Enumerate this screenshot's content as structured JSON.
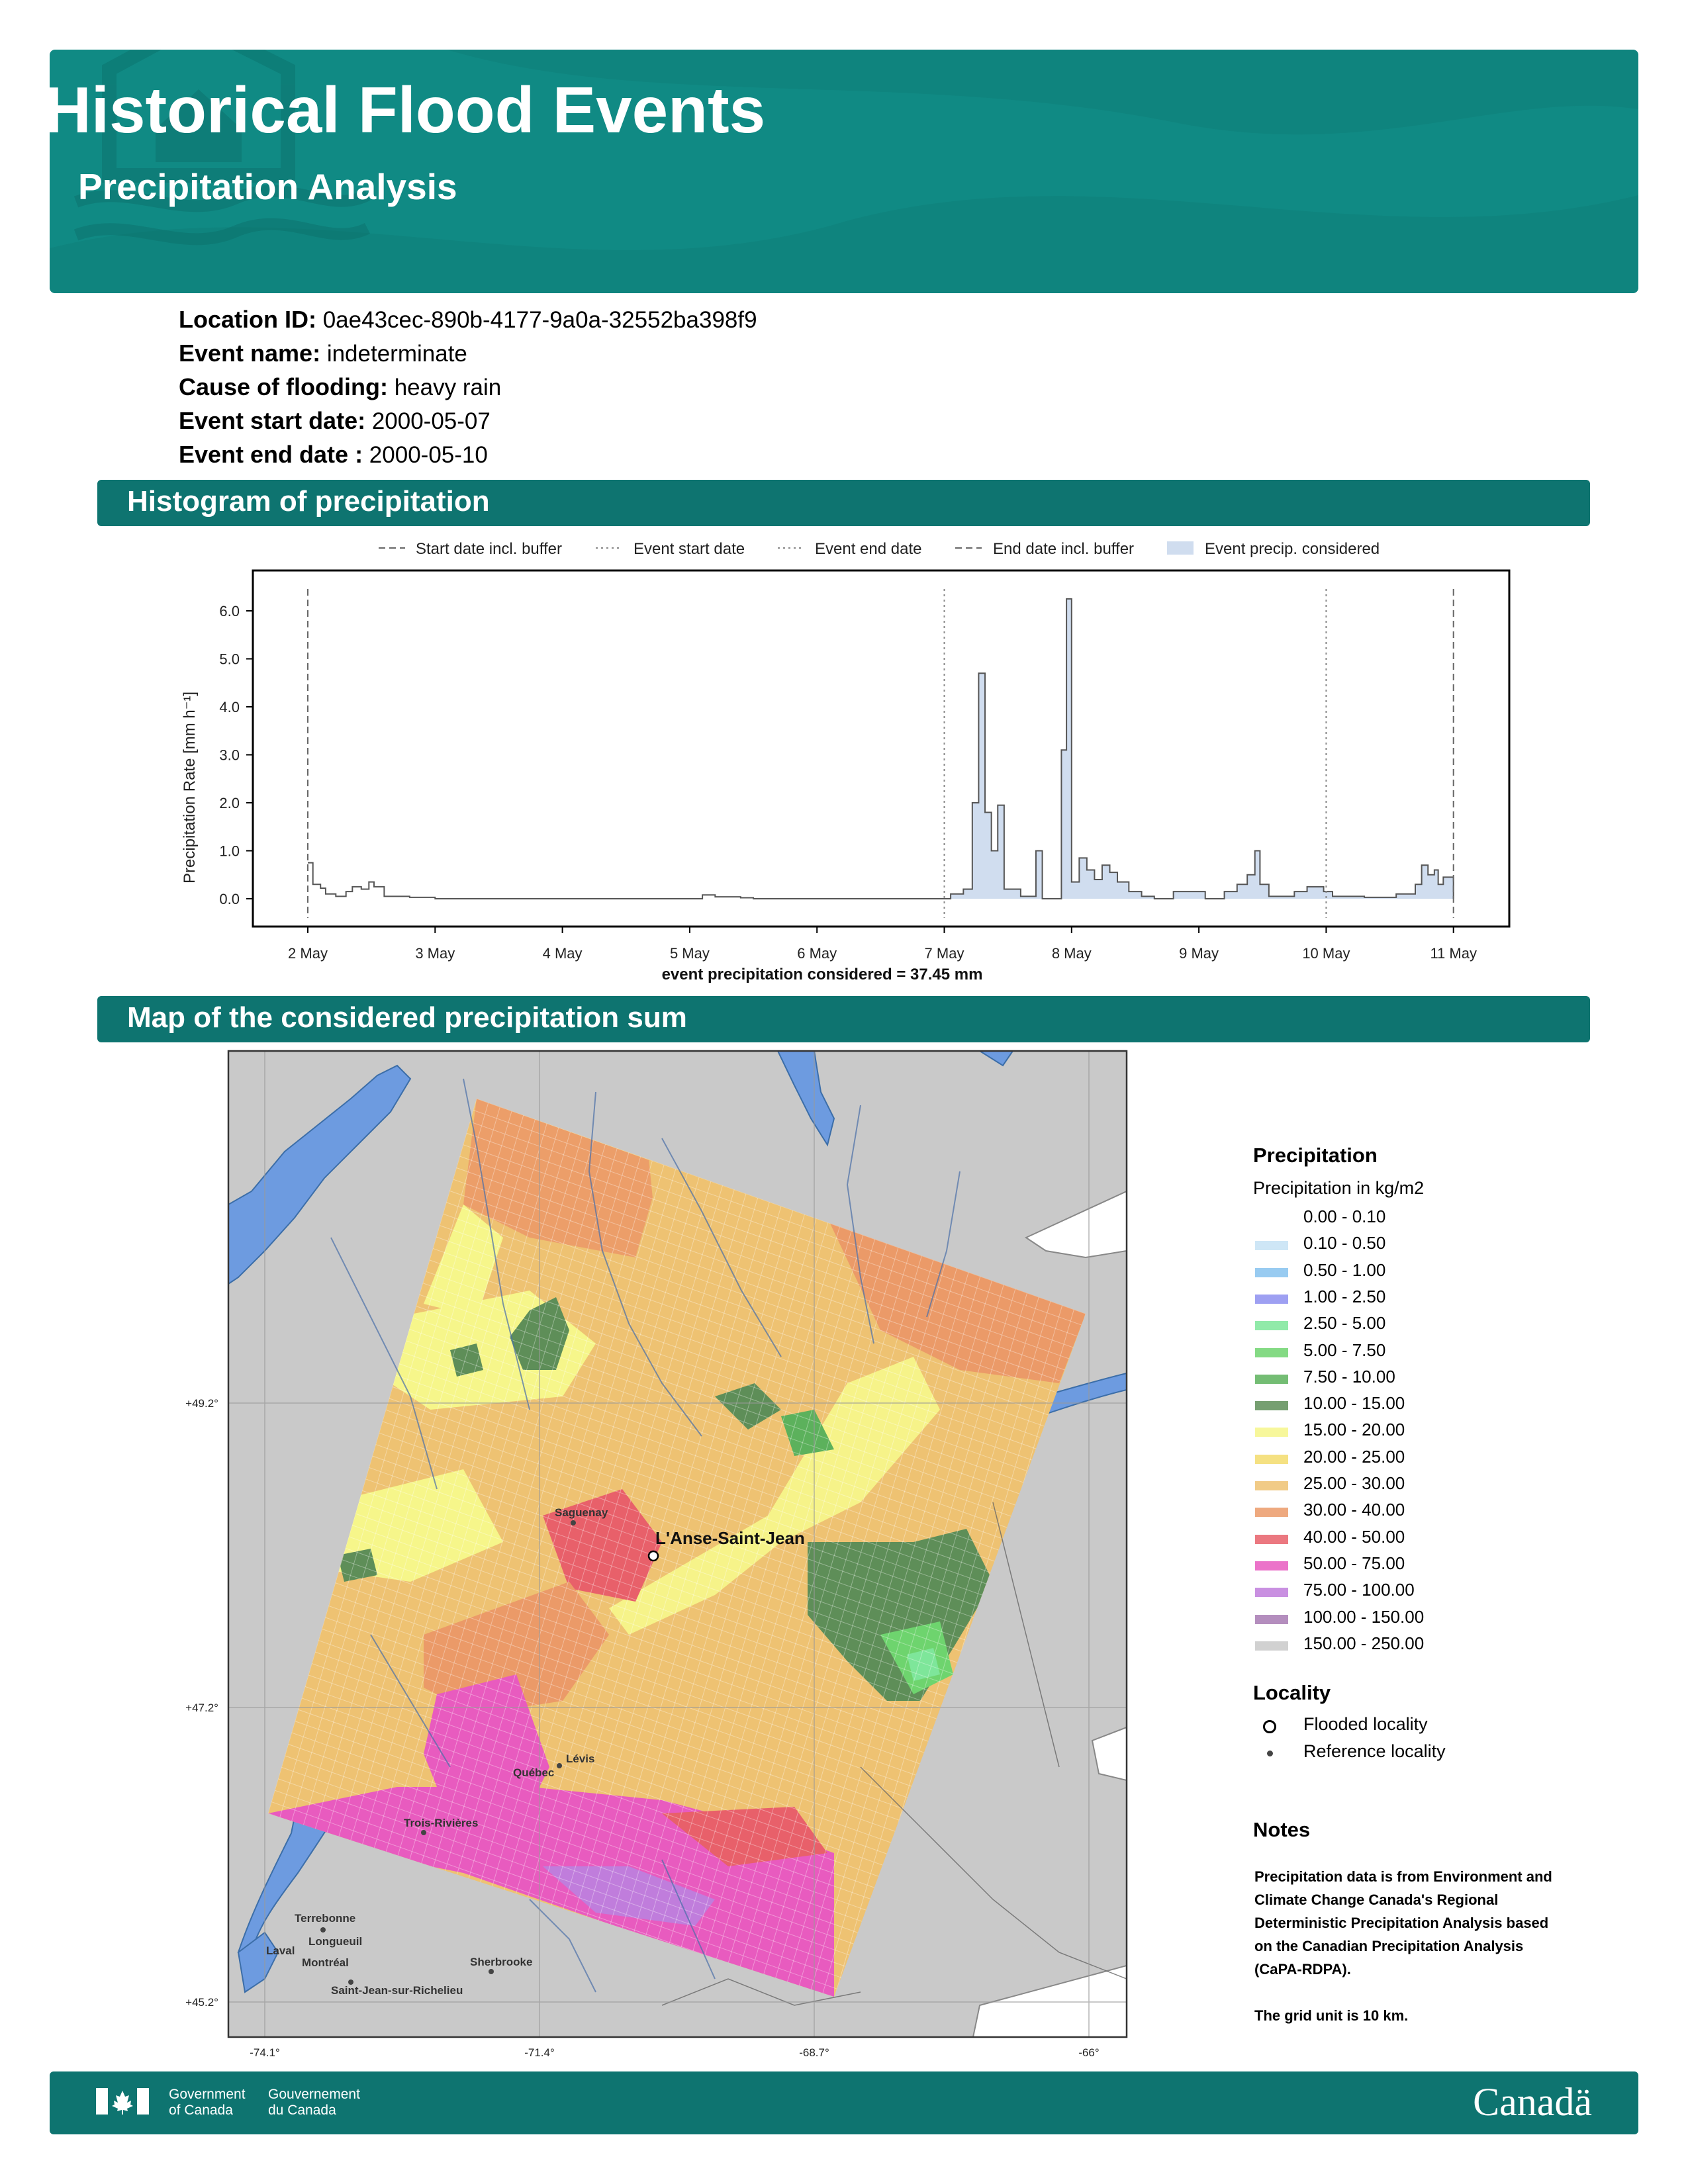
{
  "header": {
    "title": "Historical Flood Events",
    "subtitle": "Precipitation Analysis",
    "bg_color": "#108a84"
  },
  "info": [
    {
      "label": "Location ID:",
      "value": "0ae43cec-890b-4177-9a0a-32552ba398f9"
    },
    {
      "label": "Event name:",
      "value": "indeterminate"
    },
    {
      "label": "Cause of flooding:",
      "value": "heavy rain"
    },
    {
      "label": "Event start date:",
      "value": "2000-05-07"
    },
    {
      "label": "Event end date :",
      "value": "2000-05-10"
    }
  ],
  "sections": {
    "histogram": "Histogram of precipitation",
    "map": "Map of the considered precipitation sum"
  },
  "chart_data": {
    "type": "bar",
    "ylabel": "Precipitation Rate [mm h⁻¹]",
    "xlabel": "event precipitation considered = 37.45 mm",
    "ylim": [
      -0.6,
      6.8
    ],
    "yticks": [
      "0.0",
      "1.0",
      "2.0",
      "3.0",
      "4.0",
      "5.0",
      "6.0"
    ],
    "xticks": [
      "2 May",
      "3 May",
      "4 May",
      "5 May",
      "6 May",
      "7 May",
      "8 May",
      "9 May",
      "10 May",
      "11 May"
    ],
    "grid": false,
    "legend_position": "top",
    "legend": [
      {
        "label": "Start date incl. buffer",
        "style": "dashed"
      },
      {
        "label": "Event start date",
        "style": "dotted"
      },
      {
        "label": "Event end date",
        "style": "dotted"
      },
      {
        "label": "End date incl. buffer",
        "style": "dashed"
      },
      {
        "label": "Event precip. considered",
        "style": "patch"
      }
    ],
    "vlines_day": [
      0,
      5,
      8,
      9
    ],
    "event_window_day": [
      5,
      9
    ],
    "series": [
      {
        "values": [
          {
            "day": 0.0,
            "v": 0.75
          },
          {
            "day": 0.04,
            "v": 0.3
          },
          {
            "day": 0.1,
            "v": 0.22
          },
          {
            "day": 0.14,
            "v": 0.1
          },
          {
            "day": 0.22,
            "v": 0.05
          },
          {
            "day": 0.3,
            "v": 0.15
          },
          {
            "day": 0.35,
            "v": 0.25
          },
          {
            "day": 0.42,
            "v": 0.2
          },
          {
            "day": 0.48,
            "v": 0.35
          },
          {
            "day": 0.52,
            "v": 0.25
          },
          {
            "day": 0.6,
            "v": 0.05
          },
          {
            "day": 0.8,
            "v": 0.03
          },
          {
            "day": 1.0,
            "v": 0.0
          },
          {
            "day": 3.1,
            "v": 0.08
          },
          {
            "day": 3.2,
            "v": 0.04
          },
          {
            "day": 3.4,
            "v": 0.02
          },
          {
            "day": 3.5,
            "v": 0.0
          },
          {
            "day": 5.0,
            "v": 0.0
          },
          {
            "day": 5.05,
            "v": 0.1
          },
          {
            "day": 5.15,
            "v": 0.2
          },
          {
            "day": 5.22,
            "v": 2.0
          },
          {
            "day": 5.27,
            "v": 4.7
          },
          {
            "day": 5.32,
            "v": 1.8
          },
          {
            "day": 5.37,
            "v": 1.0
          },
          {
            "day": 5.42,
            "v": 1.95
          },
          {
            "day": 5.47,
            "v": 0.2
          },
          {
            "day": 5.6,
            "v": 0.05
          },
          {
            "day": 5.72,
            "v": 1.0
          },
          {
            "day": 5.77,
            "v": 0.0
          },
          {
            "day": 5.92,
            "v": 3.1
          },
          {
            "day": 5.96,
            "v": 6.25
          },
          {
            "day": 6.0,
            "v": 0.35
          },
          {
            "day": 6.06,
            "v": 0.85
          },
          {
            "day": 6.12,
            "v": 0.6
          },
          {
            "day": 6.18,
            "v": 0.4
          },
          {
            "day": 6.24,
            "v": 0.7
          },
          {
            "day": 6.3,
            "v": 0.55
          },
          {
            "day": 6.36,
            "v": 0.35
          },
          {
            "day": 6.45,
            "v": 0.15
          },
          {
            "day": 6.55,
            "v": 0.05
          },
          {
            "day": 6.65,
            "v": 0.0
          },
          {
            "day": 6.8,
            "v": 0.15
          },
          {
            "day": 7.05,
            "v": 0.0
          },
          {
            "day": 7.2,
            "v": 0.15
          },
          {
            "day": 7.3,
            "v": 0.3
          },
          {
            "day": 7.38,
            "v": 0.5
          },
          {
            "day": 7.44,
            "v": 1.0
          },
          {
            "day": 7.48,
            "v": 0.3
          },
          {
            "day": 7.55,
            "v": 0.05
          },
          {
            "day": 7.75,
            "v": 0.15
          },
          {
            "day": 7.85,
            "v": 0.25
          },
          {
            "day": 7.98,
            "v": 0.15
          },
          {
            "day": 8.05,
            "v": 0.05
          },
          {
            "day": 8.3,
            "v": 0.03
          },
          {
            "day": 8.55,
            "v": 0.1
          },
          {
            "day": 8.7,
            "v": 0.3
          },
          {
            "day": 8.75,
            "v": 0.7
          },
          {
            "day": 8.8,
            "v": 0.5
          },
          {
            "day": 8.85,
            "v": 0.6
          },
          {
            "day": 8.88,
            "v": 0.3
          },
          {
            "day": 8.92,
            "v": 0.45
          },
          {
            "day": 9.0,
            "v": 0.0
          }
        ]
      }
    ]
  },
  "map": {
    "lon_ticks": [
      "-74.1°",
      "-71.4°",
      "-68.7°",
      "-66°"
    ],
    "lat_ticks": [
      "+49.2°",
      "+47.2°",
      "+45.2°"
    ],
    "flooded_locality": "L'Anse-Saint-Jean",
    "reference_localities": [
      "Saguenay",
      "Lévis",
      "Québec",
      "Trois-Rivières",
      "Terrebonne",
      "Laval",
      "Longueuil",
      "Montréal",
      "Sherbrooke",
      "Saint-Jean-sur-Richelieu"
    ],
    "legend_title": "Precipitation",
    "legend_subtitle": "Precipitation in kg/m2",
    "classes": [
      {
        "label": "0.00 - 0.10",
        "color": "#ffffff"
      },
      {
        "label": "0.10 - 0.50",
        "color": "#c6e2f4"
      },
      {
        "label": "0.50 - 1.00",
        "color": "#86c2ee"
      },
      {
        "label": "1.00 - 2.50",
        "color": "#8d8ff0"
      },
      {
        "label": "2.50 - 5.00",
        "color": "#7ee69a"
      },
      {
        "label": "5.00 - 7.50",
        "color": "#6ed46e"
      },
      {
        "label": "7.50 - 10.00",
        "color": "#5cb15c"
      },
      {
        "label": "10.00 - 15.00",
        "color": "#5e8e58"
      },
      {
        "label": "15.00 - 20.00",
        "color": "#f6f68a"
      },
      {
        "label": "20.00 - 25.00",
        "color": "#f3dc6c"
      },
      {
        "label": "25.00 - 30.00",
        "color": "#eec272"
      },
      {
        "label": "30.00 - 40.00",
        "color": "#eb9a68"
      },
      {
        "label": "40.00 - 50.00",
        "color": "#e8606a"
      },
      {
        "label": "50.00 - 75.00",
        "color": "#e85bbf"
      },
      {
        "label": "75.00 - 100.00",
        "color": "#c07ddc"
      },
      {
        "label": "100.00 - 150.00",
        "color": "#a77ab3"
      },
      {
        "label": "150.00 - 250.00",
        "color": "#c9c9c9"
      }
    ],
    "locality_title": "Locality",
    "locality_items": [
      "Flooded locality",
      "Reference locality"
    ],
    "notes_title": "Notes",
    "notes_lines": [
      "Precipitation data is from Environment and",
      "Climate Change Canada's Regional",
      "Deterministic Precipitation Analysis based",
      "on the Canadian Precipitation Analysis",
      "(CaPA-RDPA).",
      "",
      "The grid unit is 10 km."
    ]
  },
  "footer": {
    "gov_en_1": "Government",
    "gov_en_2": "of Canada",
    "gov_fr_1": "Gouvernement",
    "gov_fr_2": "du Canada",
    "wordmark": "Canadä"
  }
}
